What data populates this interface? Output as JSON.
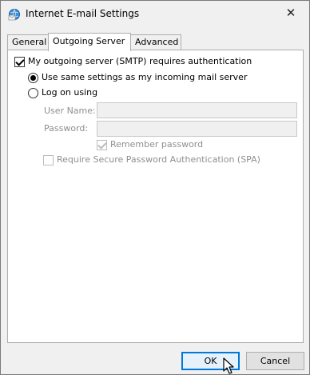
{
  "window": {
    "title": "Internet E-mail Settings",
    "close_glyph": "✕"
  },
  "tabs": [
    {
      "label": "General",
      "active": false
    },
    {
      "label": "Outgoing Server",
      "active": true
    },
    {
      "label": "Advanced",
      "active": false
    }
  ],
  "outgoing": {
    "requires_auth_label": "My outgoing server (SMTP) requires authentication",
    "requires_auth_checked": true,
    "use_same_settings_label": "Use same settings as my incoming mail server",
    "use_same_settings_selected": true,
    "log_on_using_label": "Log on using",
    "log_on_using_selected": false,
    "user_name_label": "User Name:",
    "user_name_value": "",
    "password_label": "Password:",
    "password_value": "",
    "remember_password_label": "Remember password",
    "remember_password_checked": true,
    "spa_label": "Require Secure Password Authentication (SPA)",
    "spa_checked": false
  },
  "buttons": {
    "ok_label": "OK",
    "cancel_label": "Cancel"
  },
  "colors": {
    "focus_blue": "#0078d7",
    "disabled_text": "#8f8f8f",
    "dialog_bg": "#f0f0f0"
  }
}
